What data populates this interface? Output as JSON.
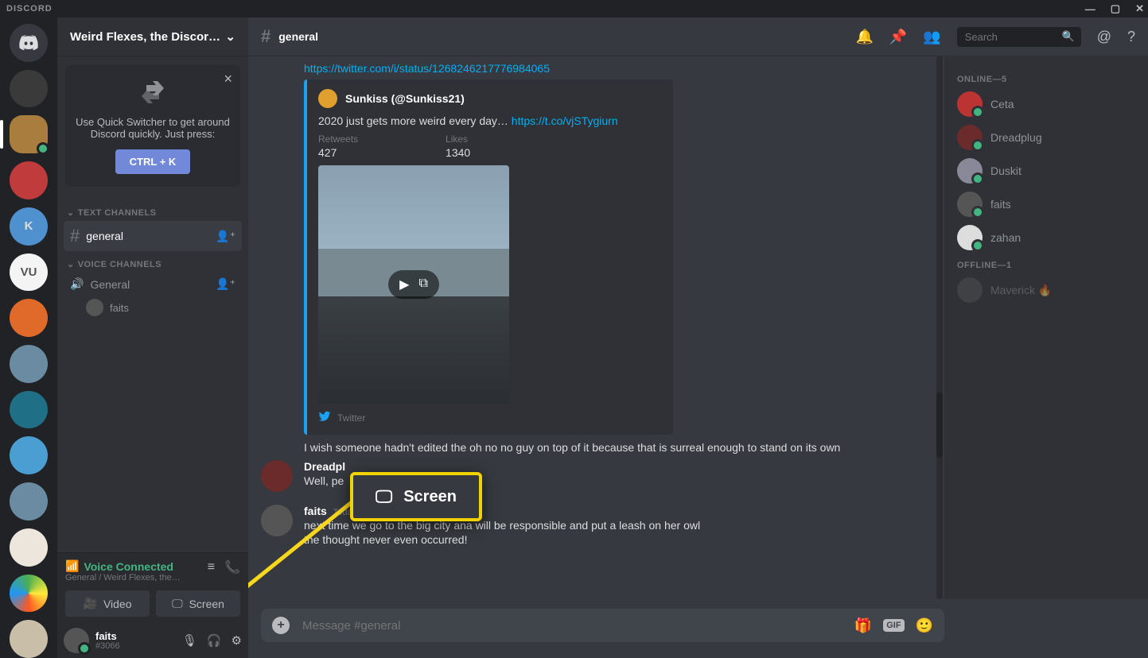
{
  "appName": "DISCORD",
  "windowControls": {
    "minimize": "—",
    "maximize": "▢",
    "close": "✕"
  },
  "serverHeader": {
    "name": "Weird Flexes, the Discor…"
  },
  "quickSwitcher": {
    "text": "Use Quick Switcher to get around Discord quickly. Just press:",
    "button": "CTRL + K"
  },
  "channels": {
    "textHeader": "Text Channels",
    "voiceHeader": "Voice Channels",
    "textItems": [
      {
        "name": "general",
        "selected": true
      }
    ],
    "voiceItems": [
      {
        "name": "General",
        "users": [
          {
            "name": "faits"
          }
        ]
      }
    ]
  },
  "voicePanel": {
    "status": "Voice Connected",
    "sub": "General / Weird Flexes, the…",
    "videoBtn": "Video",
    "screenBtn": "Screen"
  },
  "userPanel": {
    "name": "faits",
    "tag": "#3066"
  },
  "chatHeader": {
    "channel": "general",
    "searchPlaceholder": "Search"
  },
  "messages": {
    "link": "https://twitter.com/i/status/1268246217776984065",
    "embed": {
      "author": "Sunkiss (@Sunkiss21)",
      "text": "2020 just gets more weird every day… ",
      "textLink": "https://t.co/vjSTygiurn",
      "retweetsLabel": "Retweets",
      "retweets": "427",
      "likesLabel": "Likes",
      "likes": "1340",
      "footer": "Twitter"
    },
    "afterEmbed": "I wish someone hadn't edited the oh no no guy on top of it because that is surreal enough to stand on its own",
    "m2": {
      "author": "Dreadpl",
      "text": "Well, pe"
    },
    "m3": {
      "author": "faits",
      "time": "Today at 4:15 PM",
      "l1": "next time we go to the big city ana will be responsible and put a leash on her owl",
      "l2": "the thought never even occurred!"
    }
  },
  "callout": {
    "label": "Screen"
  },
  "input": {
    "placeholder": "Message #general",
    "gif": "GIF"
  },
  "members": {
    "onlineHeader": "Online—5",
    "offlineHeader": "Offline—1",
    "online": [
      {
        "name": "Ceta"
      },
      {
        "name": "Dreadplug"
      },
      {
        "name": "Duskit"
      },
      {
        "name": "faits"
      },
      {
        "name": "zahan"
      }
    ],
    "offline": [
      {
        "name": "Maverick",
        "emoji": "🔥"
      }
    ]
  }
}
